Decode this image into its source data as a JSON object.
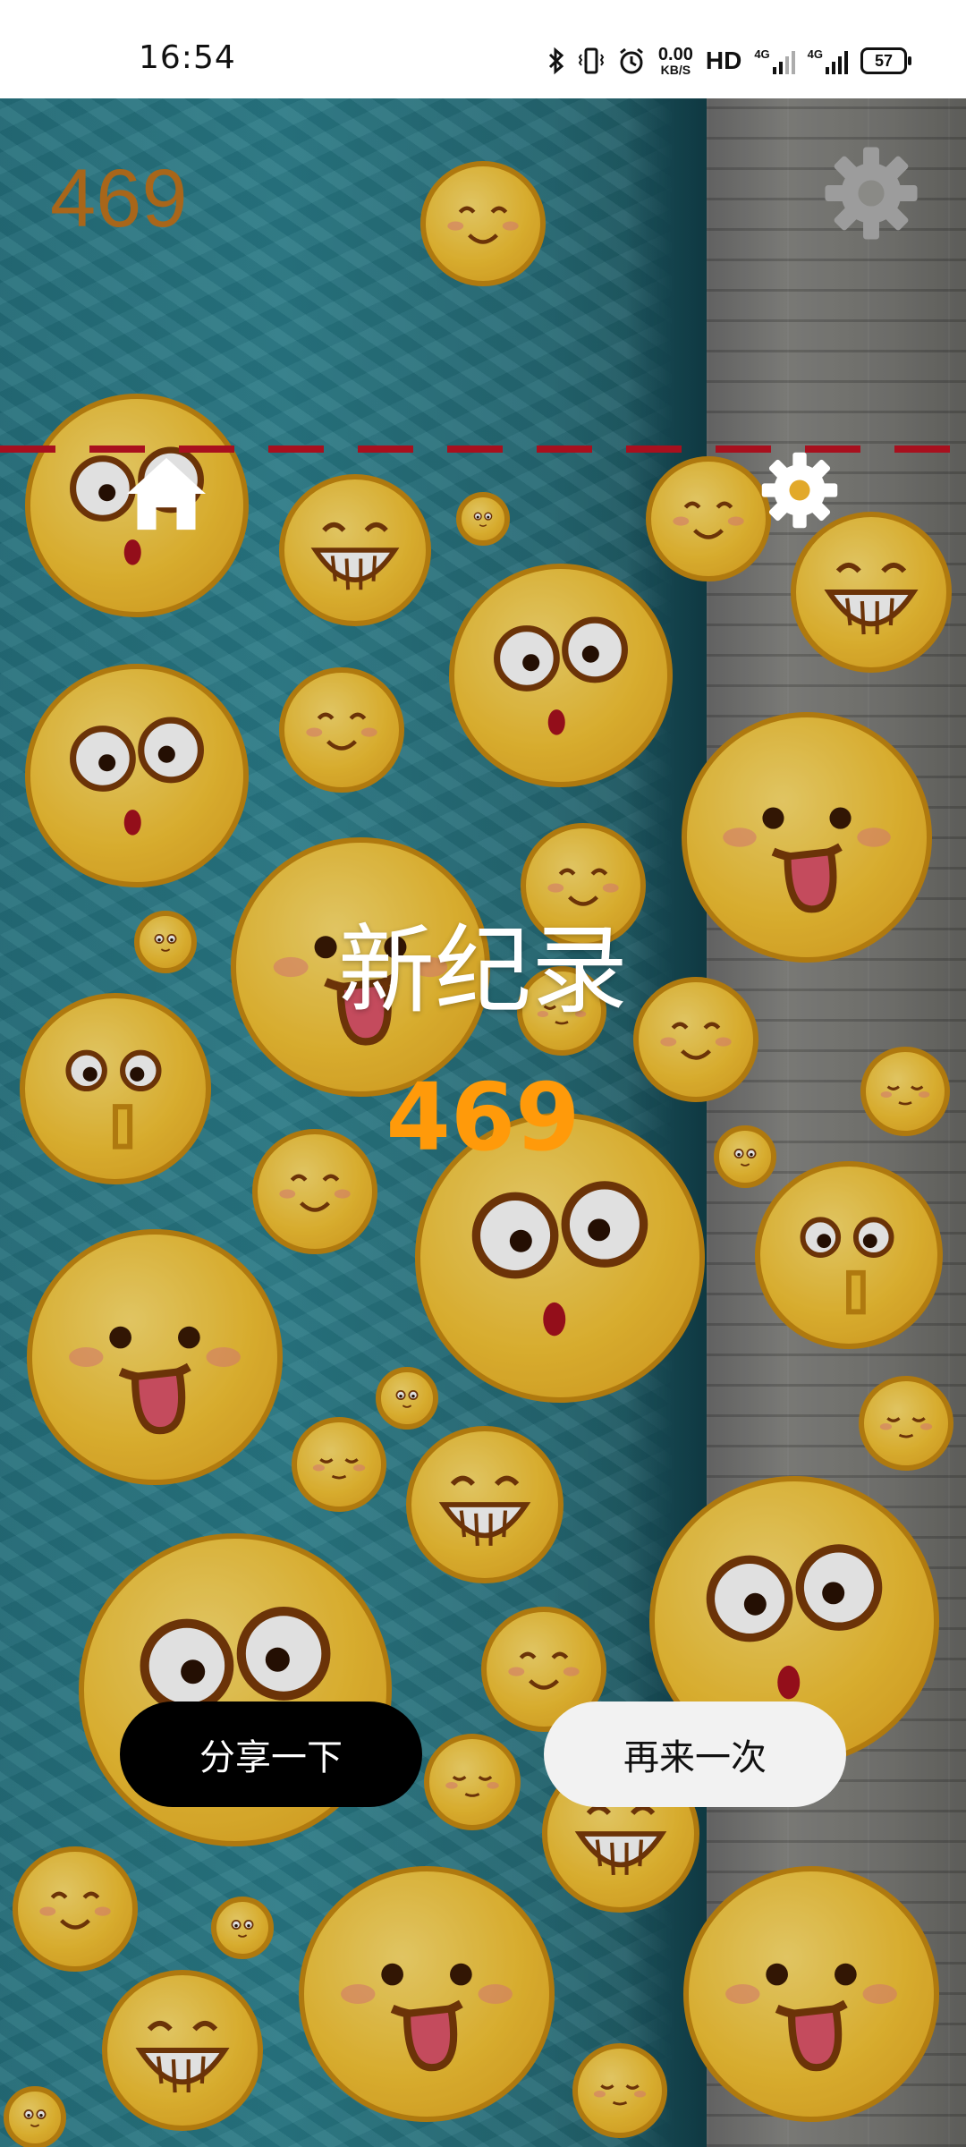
{
  "status_bar": {
    "time": "16:54",
    "net_speed_value": "0.00",
    "net_speed_unit": "KB/S",
    "hd_label": "HD",
    "sig1_label": "4G",
    "sig2_label": "4G",
    "battery_level": "57",
    "icons": [
      "bluetooth-icon",
      "vibrate-icon",
      "alarm-icon"
    ]
  },
  "game": {
    "score": "469",
    "record_title": "新纪录",
    "record_score": "469",
    "share_button": "分享一下",
    "retry_button": "再来一次",
    "colors": {
      "record_score": "#ff9a0a",
      "score": "#a8661a",
      "dash_line": "#a8101e"
    }
  }
}
